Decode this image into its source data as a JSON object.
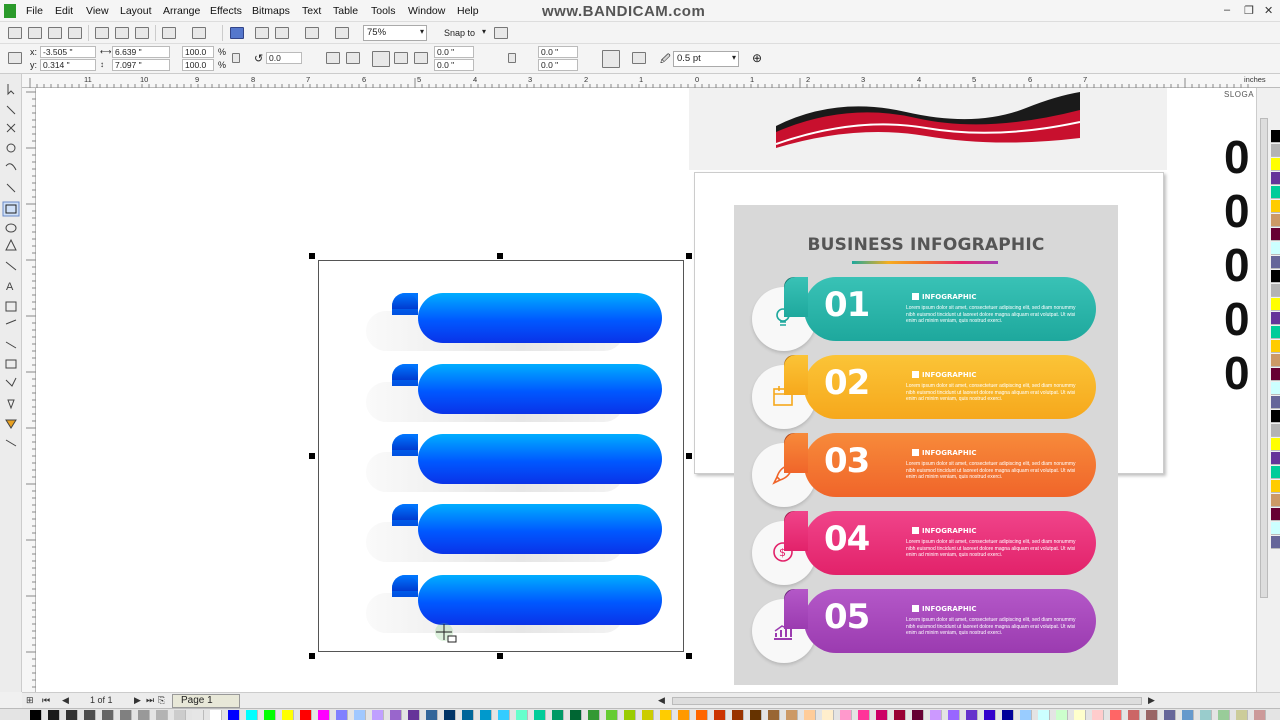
{
  "menubar": {
    "items": [
      "File",
      "Edit",
      "View",
      "Layout",
      "Arrange",
      "Effects",
      "Bitmaps",
      "Text",
      "Table",
      "Tools",
      "Window",
      "Help"
    ],
    "watermark": "www.BANDICAM.com",
    "window_controls": [
      "–",
      "❐",
      "✕"
    ]
  },
  "toolbar": {
    "zoom": "75%",
    "snap_to": "Snap to"
  },
  "properties": {
    "x_label": "x:",
    "x_value": "-3.505 \"",
    "y_label": "y:",
    "y_value": "0.314 \"",
    "width_value": "6.639 \"",
    "height_value": "7.097 \"",
    "scale_w": "100.0",
    "scale_h": "100.0",
    "percent": "%",
    "rotation": "0.0",
    "corner1": "0.0 \"",
    "corner2": "0.0 \"",
    "corner3": "0.0 \"",
    "corner4": "0.0 \"",
    "outline_width": "0.5 pt"
  },
  "ruler": {
    "top_numbers": [
      "11",
      "10",
      "9",
      "8",
      "7",
      "6",
      "5",
      "4",
      "3",
      "2",
      "1",
      "0",
      "1",
      "2",
      "3",
      "4",
      "5",
      "6",
      "7"
    ],
    "unit": "inches",
    "left_numbers": [
      "1",
      "0",
      "1",
      "2",
      "3",
      "4",
      "5",
      "6",
      "7",
      "8",
      "9"
    ]
  },
  "infographic": {
    "title": "BUSINESS INFOGRAPHIC",
    "items": [
      {
        "number": "01",
        "label": "INFOGRAPHIC",
        "desc": "Lorem ipsum dolor sit amet, consectetuer adipiscing elit, sed diam nonummy nibh euismod tincidunt ut laoreet dolore magna aliquam erat volutpat. Ut wisi enim ad minim veniam, quis nostrud exerci.",
        "color": "#1ea89d",
        "color2": "#39c2b6",
        "ribbon": "#0f6e66",
        "icon": "lightbulb-icon"
      },
      {
        "number": "02",
        "label": "INFOGRAPHIC",
        "desc": "Lorem ipsum dolor sit amet, consectetuer adipiscing elit, sed diam nonummy nibh euismod tincidunt ut laoreet dolore magna aliquam erat volutpat. Ut wisi enim ad minim veniam, quis nostrud exerci.",
        "color": "#f6a81c",
        "color2": "#fbc437",
        "ribbon": "#b8720c",
        "icon": "calendar-icon"
      },
      {
        "number": "03",
        "label": "INFOGRAPHIC",
        "desc": "Lorem ipsum dolor sit amet, consectetuer adipiscing elit, sed diam nonummy nibh euismod tincidunt ut laoreet dolore magna aliquam erat volutpat. Ut wisi enim ad minim veniam, quis nostrud exerci.",
        "color": "#f0652a",
        "color2": "#f78a3a",
        "ribbon": "#a83c12",
        "icon": "rocket-icon"
      },
      {
        "number": "04",
        "label": "INFOGRAPHIC",
        "desc": "Lorem ipsum dolor sit amet, consectetuer adipiscing elit, sed diam nonummy nibh euismod tincidunt ut laoreet dolore magna aliquam erat volutpat. Ut wisi enim ad minim veniam, quis nostrud exerci.",
        "color": "#e2226a",
        "color2": "#f0448a",
        "ribbon": "#991040",
        "icon": "money-icon"
      },
      {
        "number": "05",
        "label": "INFOGRAPHIC",
        "desc": "Lorem ipsum dolor sit amet, consectetuer adipiscing elit, sed diam nonummy nibh euismod tincidunt ut laoreet dolore magna aliquam erat volutpat. Ut wisi enim ad minim veniam, quis nostrud exerci.",
        "color": "#9b3bb0",
        "color2": "#b458c8",
        "ribbon": "#5e1e6e",
        "icon": "growth-chart-icon"
      }
    ]
  },
  "right_edge": {
    "slogan": "SLOGA",
    "zeros": [
      "0",
      "0",
      "0",
      "0",
      "0"
    ]
  },
  "pagebar": {
    "page_count": "1 of 1",
    "page_tab": "Page 1"
  },
  "colors": {
    "blue_light": "#00aeff",
    "blue_dark": "#0a33e8",
    "banner_red": "#c8102e",
    "banner_black": "#1a1a1a"
  },
  "palette": [
    "#000000",
    "#1a1a1a",
    "#333333",
    "#4d4d4d",
    "#666666",
    "#808080",
    "#999999",
    "#b3b3b3",
    "#cccccc",
    "#e6e6e6",
    "#ffffff",
    "#0000ff",
    "#00ffff",
    "#00ff00",
    "#ffff00",
    "#ff0000",
    "#ff00ff",
    "#8080ff",
    "#a0c8ff",
    "#c0a0ff",
    "#9966cc",
    "#663399",
    "#336699",
    "#003366",
    "#006699",
    "#0099cc",
    "#33ccff",
    "#66ffcc",
    "#00cc99",
    "#009966",
    "#006633",
    "#339933",
    "#66cc33",
    "#99cc00",
    "#cccc00",
    "#ffcc00",
    "#ff9900",
    "#ff6600",
    "#cc3300",
    "#993300",
    "#663300",
    "#996633",
    "#cc9966",
    "#ffcc99",
    "#ffeecc",
    "#ff99cc",
    "#ff3399",
    "#cc0066",
    "#990033",
    "#660033",
    "#cc99ff",
    "#9966ff",
    "#6633cc",
    "#3300cc",
    "#000099",
    "#99ccff",
    "#ccffff",
    "#ccffcc",
    "#ffffcc",
    "#ffcccc",
    "#ff6666",
    "#cc6666",
    "#996666",
    "#666699",
    "#6699cc",
    "#99cccc",
    "#99cc99",
    "#cccc99",
    "#cc9999",
    "#999966"
  ]
}
